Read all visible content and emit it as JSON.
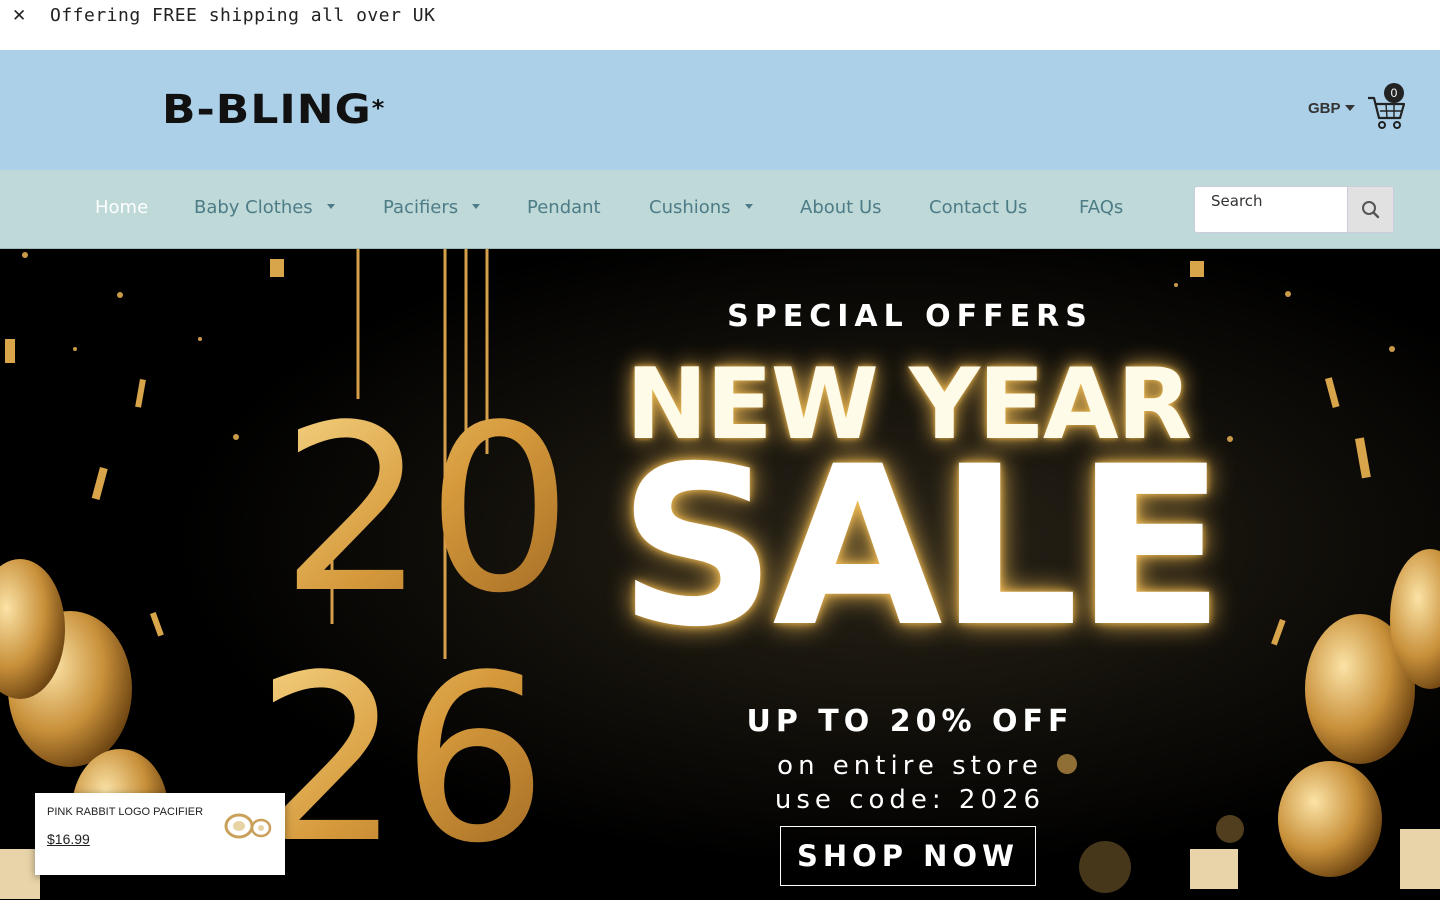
{
  "announcement": {
    "close_icon": "close-icon",
    "text": "Offering FREE shipping all over UK"
  },
  "header": {
    "logo": "B-BLING",
    "logo_star": "*",
    "currency": "GBP",
    "cart_count": "0",
    "cart_icon": "cart-icon"
  },
  "nav": {
    "items": [
      {
        "label": "Home",
        "active": true,
        "dropdown": false
      },
      {
        "label": "Baby Clothes",
        "active": false,
        "dropdown": true
      },
      {
        "label": "Pacifiers",
        "active": false,
        "dropdown": true
      },
      {
        "label": "Pendant",
        "active": false,
        "dropdown": false
      },
      {
        "label": "Cushions",
        "active": false,
        "dropdown": true
      },
      {
        "label": "About Us",
        "active": false,
        "dropdown": false
      },
      {
        "label": "Contact Us",
        "active": false,
        "dropdown": false
      },
      {
        "label": "FAQs",
        "active": false,
        "dropdown": false
      }
    ],
    "search_placeholder": "Search",
    "search_icon": "search-icon"
  },
  "hero": {
    "special_offers": "SPECIAL OFFERS",
    "headline": "NEW YEAR",
    "sale": "SALE",
    "discount": "UP TO 20% OFF",
    "line1": "on entire store",
    "line2": "use code: 2026",
    "cta": "SHOP NOW",
    "year_top": "20",
    "year_bottom": "26"
  },
  "popup": {
    "product_name": "PINK RABBIT LOGO PACIFIER",
    "price": "$16.99"
  },
  "colors": {
    "header_bg": "#abd0e8",
    "nav_bg": "#bfd9d9",
    "nav_text": "#4d7c86",
    "gold": "#e3a646"
  }
}
